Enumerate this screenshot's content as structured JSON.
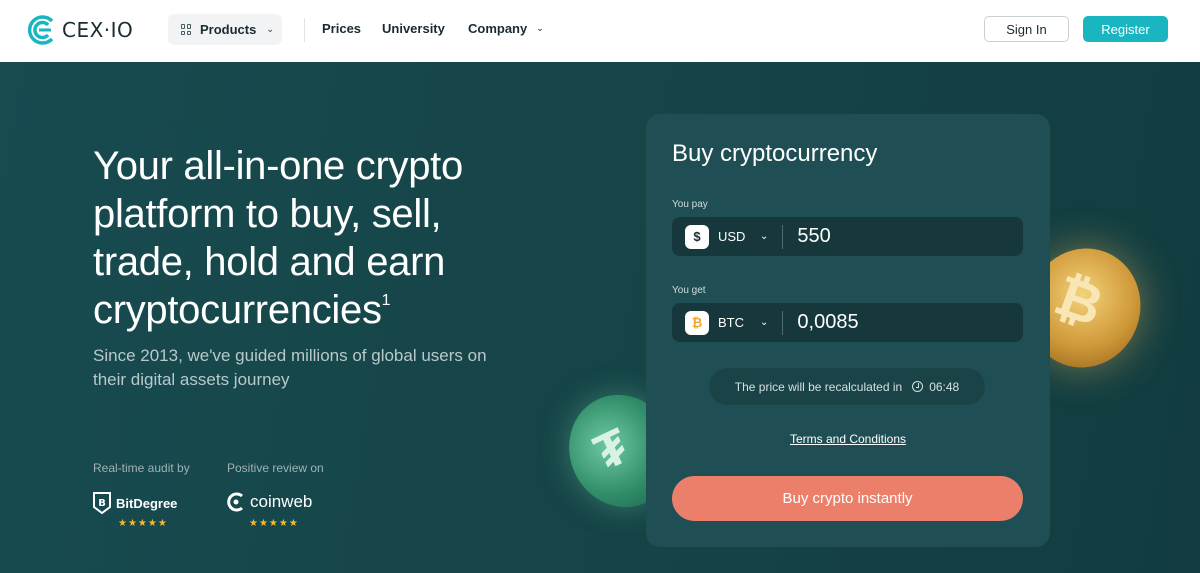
{
  "header": {
    "logo_text": "CEX·IO",
    "nav": {
      "products": "Products",
      "prices": "Prices",
      "university": "University",
      "company": "Company"
    },
    "sign_in": "Sign In",
    "register": "Register"
  },
  "hero": {
    "headline": "Your all-in-one crypto platform to buy, sell, trade, hold and earn cryptocurrencies",
    "headline_sup": "1",
    "subhead": "Since 2013, we've guided millions of global users on their digital assets journey",
    "audit_label": "Real-time audit by",
    "review_label": "Positive review on",
    "audit_brand": "BitDegree",
    "review_brand": "coinweb",
    "audit_stars": "★★★★★",
    "review_stars": "★★★★★"
  },
  "card": {
    "title": "Buy cryptocurrency",
    "pay_label": "You pay",
    "pay_currency": "USD",
    "pay_symbol": "$",
    "pay_amount": "550",
    "get_label": "You get",
    "get_currency": "BTC",
    "get_symbol": "₿",
    "get_amount": "0,0085",
    "timer_text": "The price will be recalculated in",
    "timer_value": "06:48",
    "terms": "Terms and Conditions",
    "buy_button": "Buy crypto instantly"
  },
  "colors": {
    "accent": "#19b5c0",
    "buy_button": "#ec7f6a",
    "hero_bg": "#164548",
    "card_bg": "#1f4f55"
  }
}
